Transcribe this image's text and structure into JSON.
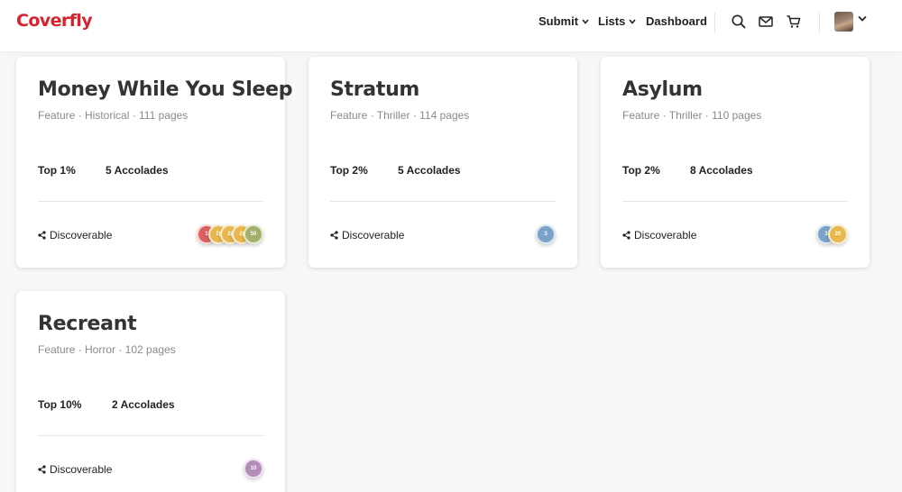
{
  "brand": "Coverfly",
  "nav": {
    "submit": "Submit",
    "lists": "Lists",
    "dashboard": "Dashboard"
  },
  "header_icons": [
    "search-icon",
    "mail-icon",
    "cart-icon",
    "avatar",
    "chevron-down-icon"
  ],
  "colors": {
    "brand": "#d6232e",
    "badge_red": "#d9605e",
    "badge_gold": "#e8b84d",
    "badge_olive": "#a2b06a",
    "badge_blue": "#7ba3c9",
    "badge_purple": "#b38cb8"
  },
  "projects": [
    {
      "title": "Money While You Sleep",
      "meta": "Feature · Historical · 111 pages",
      "rank": "Top 1%",
      "accolades": "5 Accolades",
      "discover": "Discoverable",
      "badges": [
        {
          "label": "1",
          "color": "#d9605e"
        },
        {
          "label": "2(",
          "color": "#e8b84d"
        },
        {
          "label": "2(",
          "color": "#e8b84d"
        },
        {
          "label": "2(",
          "color": "#e8b84d"
        },
        {
          "label": "50",
          "color": "#a2b06a"
        }
      ]
    },
    {
      "title": "Stratum",
      "meta": "Feature · Thriller · 114 pages",
      "rank": "Top 2%",
      "accolades": "5 Accolades",
      "discover": "Discoverable",
      "badges": [
        {
          "label": "3",
          "color": "#7ba3c9"
        }
      ]
    },
    {
      "title": "Asylum",
      "meta": "Feature · Thriller · 110 pages",
      "rank": "Top 2%",
      "accolades": "8 Accolades",
      "discover": "Discoverable",
      "badges": [
        {
          "label": "3",
          "color": "#7ba3c9"
        },
        {
          "label": "20",
          "color": "#e8b84d"
        }
      ]
    },
    {
      "title": "Recreant",
      "meta": "Feature · Horror · 102 pages",
      "rank": "Top 10%",
      "accolades": "2 Accolades",
      "discover": "Discoverable",
      "badges": [
        {
          "label": "10",
          "color": "#b38cb8"
        }
      ]
    }
  ]
}
